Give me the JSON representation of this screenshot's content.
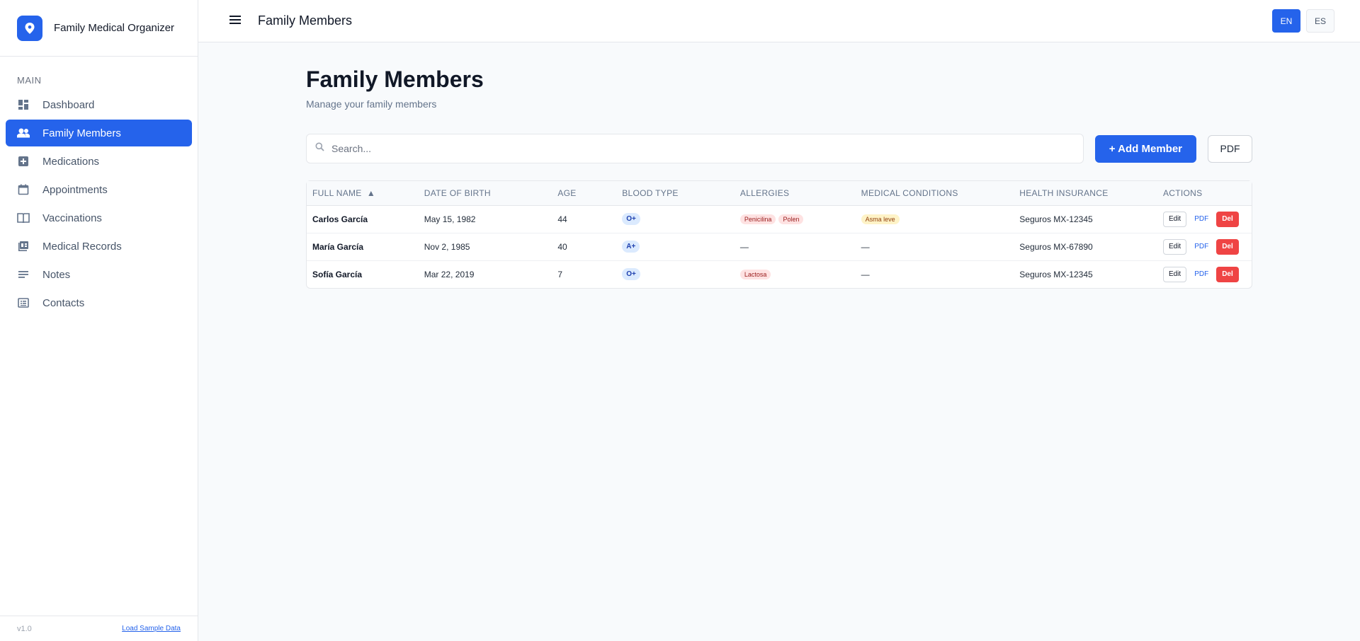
{
  "app": {
    "name": "Family Medical Organizer",
    "version": "v1.0",
    "load_sample_label": "Load Sample Data"
  },
  "colors": {
    "accent": "#2563eb",
    "danger": "#ef4444"
  },
  "sidebar": {
    "section_label": "MAIN",
    "items": [
      {
        "label": "Dashboard",
        "icon": "dashboard-icon"
      },
      {
        "label": "Family Members",
        "icon": "people-icon",
        "active": true
      },
      {
        "label": "Medications",
        "icon": "medical-plus-icon"
      },
      {
        "label": "Appointments",
        "icon": "calendar-icon"
      },
      {
        "label": "Vaccinations",
        "icon": "book-icon"
      },
      {
        "label": "Medical Records",
        "icon": "records-icon"
      },
      {
        "label": "Notes",
        "icon": "notes-icon"
      },
      {
        "label": "Contacts",
        "icon": "contacts-icon"
      }
    ]
  },
  "topbar": {
    "title": "Family Members",
    "languages": [
      {
        "label": "EN",
        "active": true
      },
      {
        "label": "ES",
        "active": false
      }
    ]
  },
  "main": {
    "title": "Family Members",
    "subtitle": "Manage your family members",
    "search_placeholder": "Search...",
    "add_button": "+ Add Member",
    "pdf_button": "PDF"
  },
  "table": {
    "sort_indicator": "▲",
    "columns": [
      "FULL NAME",
      "DATE OF BIRTH",
      "AGE",
      "BLOOD TYPE",
      "ALLERGIES",
      "MEDICAL CONDITIONS",
      "HEALTH INSURANCE",
      "ACTIONS"
    ],
    "action_labels": {
      "edit": "Edit",
      "pdf": "PDF",
      "delete": "Del"
    },
    "rows": [
      {
        "name": "Carlos García",
        "dob": "May 15, 1982",
        "age": "44",
        "blood": "O+",
        "allergies": [
          "Penicilina",
          "Polen"
        ],
        "conditions": [
          "Asma leve"
        ],
        "insurance": "Seguros MX-12345"
      },
      {
        "name": "María García",
        "dob": "Nov 2, 1985",
        "age": "40",
        "blood": "A+",
        "allergies": [],
        "conditions": [],
        "insurance": "Seguros MX-67890"
      },
      {
        "name": "Sofía García",
        "dob": "Mar 22, 2019",
        "age": "7",
        "blood": "O+",
        "allergies": [
          "Lactosa"
        ],
        "conditions": [],
        "insurance": "Seguros MX-12345"
      }
    ],
    "empty_value": "—"
  }
}
